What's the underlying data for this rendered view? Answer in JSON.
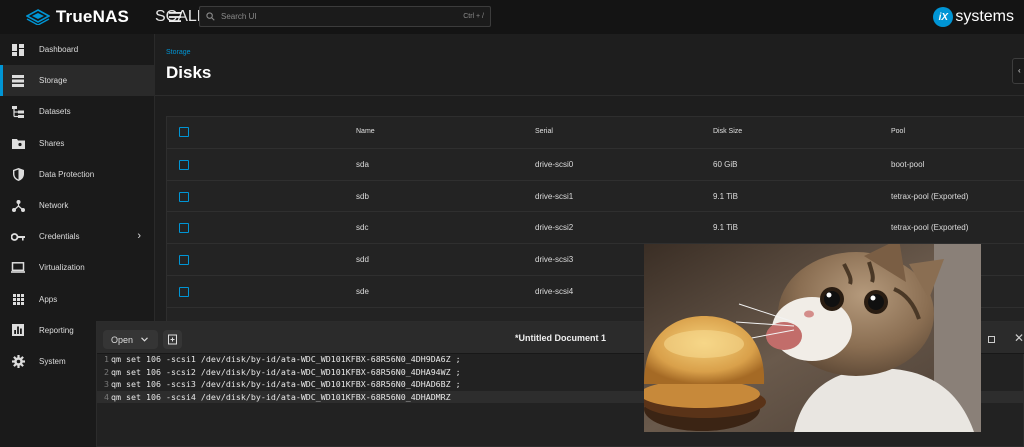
{
  "topbar": {
    "brand_name": "TrueNAS",
    "brand_sub": "SCALE",
    "search_placeholder": "Search UI",
    "search_shortcut": "Ctrl + /",
    "vendor_logo_letters": "iX",
    "vendor_logo_word": "systems"
  },
  "sidebar": {
    "items": [
      {
        "label": "Dashboard",
        "icon": "dashboard-icon"
      },
      {
        "label": "Storage",
        "icon": "storage-icon",
        "active": true
      },
      {
        "label": "Datasets",
        "icon": "datasets-icon"
      },
      {
        "label": "Shares",
        "icon": "shares-icon"
      },
      {
        "label": "Data Protection",
        "icon": "shield-icon"
      },
      {
        "label": "Network",
        "icon": "network-icon"
      },
      {
        "label": "Credentials",
        "icon": "key-icon",
        "has_submenu": true
      },
      {
        "label": "Virtualization",
        "icon": "laptop-icon"
      },
      {
        "label": "Apps",
        "icon": "apps-grid-icon"
      },
      {
        "label": "Reporting",
        "icon": "reporting-icon"
      },
      {
        "label": "System",
        "icon": "gear-icon"
      }
    ],
    "chevron": "›"
  },
  "page": {
    "breadcrumb": "Storage",
    "title": "Disks"
  },
  "disks_table": {
    "columns": [
      "Name",
      "Serial",
      "Disk Size",
      "Pool"
    ],
    "rows": [
      {
        "name": "sda",
        "serial": "drive-scsi0",
        "size": "60 GiB",
        "pool": "boot-pool"
      },
      {
        "name": "sdb",
        "serial": "drive-scsi1",
        "size": "9.1 TiB",
        "pool": "tetrax-pool (Exported)"
      },
      {
        "name": "sdc",
        "serial": "drive-scsi2",
        "size": "9.1 TiB",
        "pool": "tetrax-pool (Exported)"
      },
      {
        "name": "sdd",
        "serial": "drive-scsi3",
        "size": "",
        "pool": ""
      },
      {
        "name": "sde",
        "serial": "drive-scsi4",
        "size": "",
        "pool": ""
      }
    ]
  },
  "editor": {
    "open_label": "Open",
    "title": "*Untitled Document 1",
    "lines": [
      {
        "num": "1",
        "text": "qm set 106 -scsi1 /dev/disk/by-id/ata-WDC_WD101KFBX-68R56N0_4DH9DA6Z ;"
      },
      {
        "num": "2",
        "text": "qm set 106 -scsi2 /dev/disk/by-id/ata-WDC_WD101KFBX-68R56N0_4DHA94WZ ;"
      },
      {
        "num": "3",
        "text": "qm set 106 -scsi3 /dev/disk/by-id/ata-WDC_WD101KFBX-68R56N0_4DHAD6BZ ;"
      },
      {
        "num": "4",
        "text": "qm set 106 -scsi4 /dev/disk/by-id/ata-WDC_WD101KFBX-68R56N0_4DHADMRZ"
      }
    ]
  },
  "colors": {
    "accent": "#0095d5",
    "background": "#1e1e1e",
    "sidebar": "#1a1a1a",
    "card": "#232323"
  }
}
